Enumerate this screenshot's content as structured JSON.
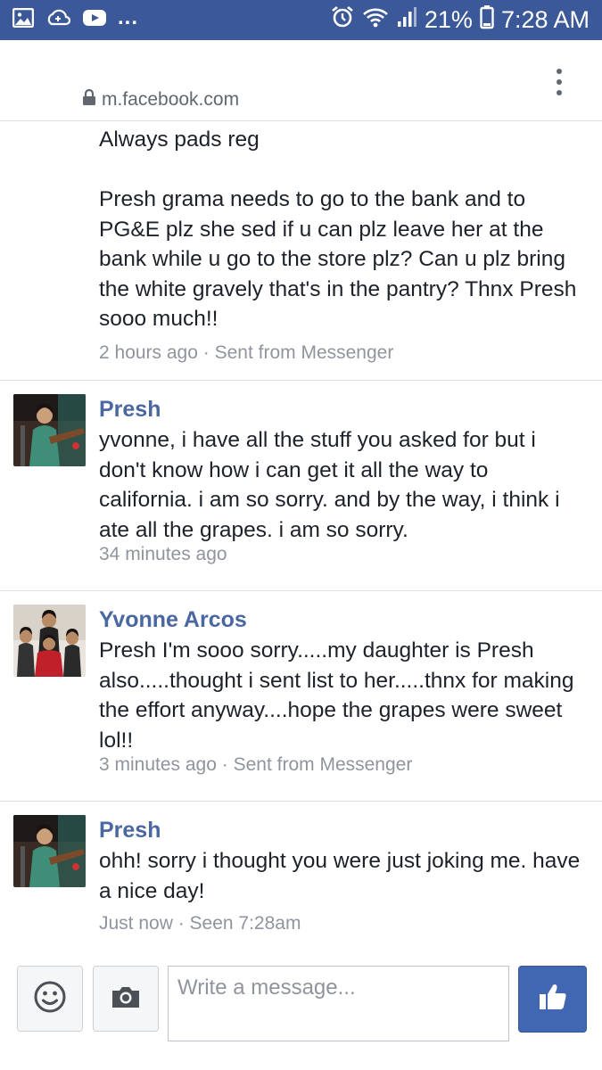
{
  "status_bar": {
    "battery": "21%",
    "time": "7:28 AM",
    "notifications": "...",
    "icons": [
      "gallery-icon",
      "cloud-sync-icon",
      "youtube-icon",
      "alarm-icon",
      "wifi-icon",
      "signal-icon",
      "battery-icon"
    ]
  },
  "browser": {
    "url": "m.facebook.com",
    "icons": [
      "lock-icon",
      "overflow-menu-icon"
    ]
  },
  "messages": [
    {
      "sender": "",
      "body": "Always pads reg\n\nPresh grama needs to go to the bank and to PG&E plz she sed if u can plz leave her at the bank while u go to the store plz? Can u plz bring the white gravely that's in the pantry? Thnx Presh sooo much!!",
      "meta": "2 hours ago · Sent from Messenger"
    },
    {
      "sender": "Presh",
      "body": "yvonne, i have all the stuff you asked for but i don't know how i can get it all the way to california. i am so sorry. and by the way, i think i ate all the grapes. i am so sorry.",
      "meta": "34 minutes ago"
    },
    {
      "sender": "Yvonne Arcos",
      "body": "Presh I'm sooo sorry.....my daughter is Presh also.....thought i sent list to her.....thnx for making the effort anyway....hope the grapes were sweet lol!!",
      "meta": "3 minutes ago · Sent from Messenger"
    },
    {
      "sender": "Presh",
      "body": "ohh! sorry i thought you were just joking me. have a nice day!",
      "meta": "Just now · Seen 7:28am"
    }
  ],
  "composer": {
    "placeholder": "Write a message...",
    "icons": [
      "emoji-icon",
      "camera-icon",
      "thumbs-up-icon"
    ]
  },
  "colors": {
    "status_bar_bg": "#3b5998",
    "sender_name": "#4b67a1",
    "meta_text": "#90949c",
    "like_button": "#4267b2"
  }
}
